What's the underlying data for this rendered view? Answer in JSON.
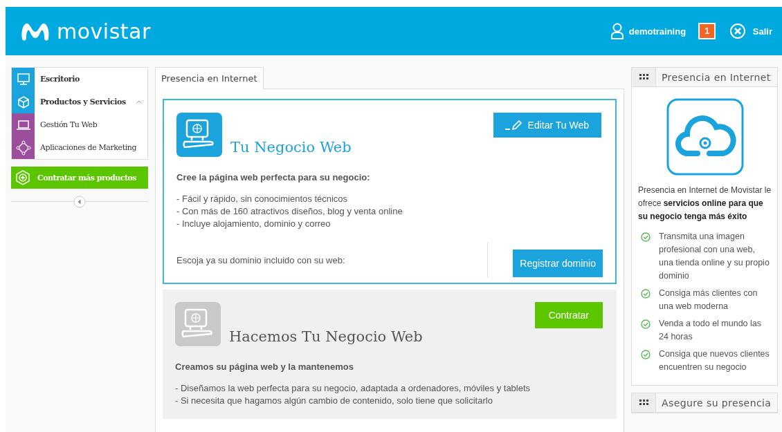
{
  "header": {
    "brand": "movistar",
    "user": "demotraining",
    "notifications": "1",
    "logout": "Salir"
  },
  "sidebar": {
    "items": [
      {
        "label": "Escritorio",
        "color": "#1aa3dc"
      },
      {
        "label": "Productos y Servicios",
        "color": "#1aa3dc",
        "expanded": true,
        "children": [
          {
            "label": "Gestión Tu Web",
            "color": "#9b4e9c"
          },
          {
            "label": "Aplicaciones de Marketing",
            "color": "#9b4e9c"
          }
        ]
      }
    ],
    "cta": "Contratar más productos"
  },
  "tabs": [
    {
      "label": "Presencia en Internet",
      "selected": true
    }
  ],
  "cards": [
    {
      "kind": "active",
      "title": "Tu Negocio Web",
      "button": "Editar Tu Web",
      "subtitle": "Cree la página web perfecta para su negocio:",
      "bullets": [
        "- Fácil y rápido, sin conocimientos técnicos",
        "- Con más de 160 atractivos diseños, blog y venta online",
        "- Incluye alojamiento, dominio y correo"
      ],
      "domain_text": "Escoja ya su dominio incluido con su web:",
      "domain_button": "Registrar dominio"
    },
    {
      "kind": "offer",
      "title": "Hacemos Tu Negocio Web",
      "button": "Contratar",
      "subtitle": "Creamos su página web y la mantenemos",
      "bullets": [
        "- Diseñamos la web perfecta para su negocio, adaptada a ordenadores, móviles y tablets",
        "- Si necesita que hagamos algún cambio de contenido, solo tiene que solicitarlo"
      ]
    }
  ],
  "right_panels": [
    {
      "title": "Presencia en Internet",
      "intro": "Presencia en Internet de Movistar le ofrece **servicios online para que su negocio tenga más éxito**",
      "benefits": [
        "Transmita una imagen profesional con una web, una tienda online y su propio dominio",
        "Consiga más clientes con una web moderna",
        "Venda a todo el mundo las 24 horas",
        "Consiga que nuevos clientes encuentren su negocio"
      ]
    },
    {
      "title": "Asegure su presencia"
    }
  ]
}
